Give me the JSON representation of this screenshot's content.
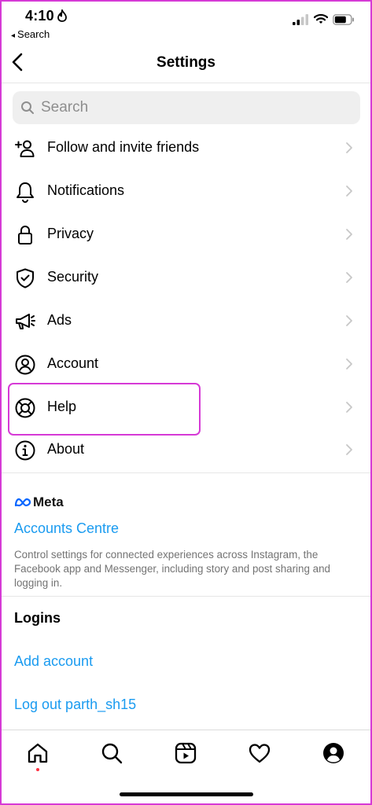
{
  "status_bar": {
    "time": "4:10",
    "back_app": "Search",
    "back_arrow": "◂"
  },
  "header": {
    "title": "Settings"
  },
  "search": {
    "placeholder": "Search"
  },
  "menu": [
    {
      "label": "Follow and invite friends",
      "icon": "add-person-icon"
    },
    {
      "label": "Notifications",
      "icon": "bell-icon"
    },
    {
      "label": "Privacy",
      "icon": "lock-icon"
    },
    {
      "label": "Security",
      "icon": "shield-icon"
    },
    {
      "label": "Ads",
      "icon": "megaphone-icon"
    },
    {
      "label": "Account",
      "icon": "person-circle-icon"
    },
    {
      "label": "Help",
      "icon": "lifebuoy-icon"
    },
    {
      "label": "About",
      "icon": "info-icon"
    }
  ],
  "meta": {
    "brand": "Meta",
    "accounts_centre": "Accounts Centre",
    "description": "Control settings for connected experiences across Instagram, the Facebook app and Messenger, including story and post sharing and logging in."
  },
  "logins": {
    "title": "Logins",
    "add_account": "Add account",
    "log_out": "Log out parth_sh15"
  },
  "tabbar": [
    "home-icon",
    "search-icon",
    "reels-icon",
    "heart-icon",
    "profile-icon"
  ],
  "colors": {
    "link": "#1a9bf0",
    "highlight": "#d63ad6",
    "notification_dot": "#ff3040"
  }
}
